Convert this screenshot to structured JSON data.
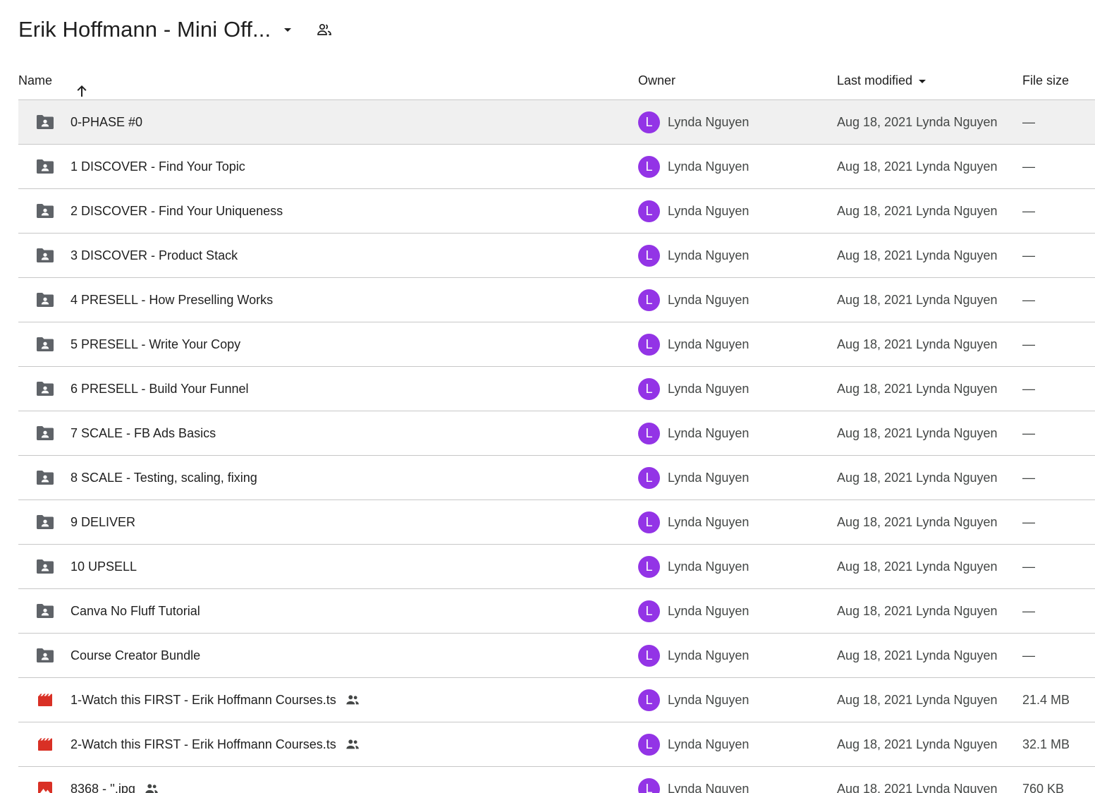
{
  "header": {
    "folder_title": "Erik Hoffmann - Mini Off...",
    "dropdown_icon": "arrow-drop-down-icon",
    "shared_icon": "people-outline-icon"
  },
  "columns": {
    "name": "Name",
    "owner": "Owner",
    "last_modified": "Last modified",
    "file_size": "File size",
    "sort_icon": "arrow-upward-icon",
    "modified_sort_icon": "arrow-drop-down-icon"
  },
  "colors": {
    "avatar": "#9334e6",
    "folder_icon": "#5f6368",
    "video_icon": "#d93025",
    "image_icon": "#d93025",
    "selected_row": "#f0f0f0",
    "divider": "#c7c7c7"
  },
  "rows": [
    {
      "type": "shared-folder",
      "icon": "shared-folder-icon",
      "name": "0-PHASE #0",
      "shared": false,
      "avatar_letter": "L",
      "owner": "Lynda Nguyen",
      "modified": "Aug 18, 2021 Lynda Nguyen",
      "size": "—",
      "selected": true
    },
    {
      "type": "shared-folder",
      "icon": "shared-folder-icon",
      "name": "1 DISCOVER - Find Your Topic",
      "shared": false,
      "avatar_letter": "L",
      "owner": "Lynda Nguyen",
      "modified": "Aug 18, 2021 Lynda Nguyen",
      "size": "—",
      "selected": false
    },
    {
      "type": "shared-folder",
      "icon": "shared-folder-icon",
      "name": "2 DISCOVER - Find Your Uniqueness",
      "shared": false,
      "avatar_letter": "L",
      "owner": "Lynda Nguyen",
      "modified": "Aug 18, 2021 Lynda Nguyen",
      "size": "—",
      "selected": false
    },
    {
      "type": "shared-folder",
      "icon": "shared-folder-icon",
      "name": "3 DISCOVER - Product Stack",
      "shared": false,
      "avatar_letter": "L",
      "owner": "Lynda Nguyen",
      "modified": "Aug 18, 2021 Lynda Nguyen",
      "size": "—",
      "selected": false
    },
    {
      "type": "shared-folder",
      "icon": "shared-folder-icon",
      "name": "4 PRESELL - How Preselling Works",
      "shared": false,
      "avatar_letter": "L",
      "owner": "Lynda Nguyen",
      "modified": "Aug 18, 2021 Lynda Nguyen",
      "size": "—",
      "selected": false
    },
    {
      "type": "shared-folder",
      "icon": "shared-folder-icon",
      "name": "5 PRESELL - Write Your Copy",
      "shared": false,
      "avatar_letter": "L",
      "owner": "Lynda Nguyen",
      "modified": "Aug 18, 2021 Lynda Nguyen",
      "size": "—",
      "selected": false
    },
    {
      "type": "shared-folder",
      "icon": "shared-folder-icon",
      "name": "6 PRESELL - Build Your Funnel",
      "shared": false,
      "avatar_letter": "L",
      "owner": "Lynda Nguyen",
      "modified": "Aug 18, 2021 Lynda Nguyen",
      "size": "—",
      "selected": false
    },
    {
      "type": "shared-folder",
      "icon": "shared-folder-icon",
      "name": "7 SCALE - FB Ads Basics",
      "shared": false,
      "avatar_letter": "L",
      "owner": "Lynda Nguyen",
      "modified": "Aug 18, 2021 Lynda Nguyen",
      "size": "—",
      "selected": false
    },
    {
      "type": "shared-folder",
      "icon": "shared-folder-icon",
      "name": "8 SCALE - Testing, scaling, fixing",
      "shared": false,
      "avatar_letter": "L",
      "owner": "Lynda Nguyen",
      "modified": "Aug 18, 2021 Lynda Nguyen",
      "size": "—",
      "selected": false
    },
    {
      "type": "shared-folder",
      "icon": "shared-folder-icon",
      "name": "9 DELIVER",
      "shared": false,
      "avatar_letter": "L",
      "owner": "Lynda Nguyen",
      "modified": "Aug 18, 2021 Lynda Nguyen",
      "size": "—",
      "selected": false
    },
    {
      "type": "shared-folder",
      "icon": "shared-folder-icon",
      "name": "10 UPSELL",
      "shared": false,
      "avatar_letter": "L",
      "owner": "Lynda Nguyen",
      "modified": "Aug 18, 2021 Lynda Nguyen",
      "size": "—",
      "selected": false
    },
    {
      "type": "shared-folder",
      "icon": "shared-folder-icon",
      "name": "Canva No Fluff Tutorial",
      "shared": false,
      "avatar_letter": "L",
      "owner": "Lynda Nguyen",
      "modified": "Aug 18, 2021 Lynda Nguyen",
      "size": "—",
      "selected": false
    },
    {
      "type": "shared-folder",
      "icon": "shared-folder-icon",
      "name": "Course Creator Bundle",
      "shared": false,
      "avatar_letter": "L",
      "owner": "Lynda Nguyen",
      "modified": "Aug 18, 2021 Lynda Nguyen",
      "size": "—",
      "selected": false
    },
    {
      "type": "video",
      "icon": "video-file-icon",
      "name": "1-Watch this FIRST - Erik Hoffmann Courses.ts",
      "shared": true,
      "avatar_letter": "L",
      "owner": "Lynda Nguyen",
      "modified": "Aug 18, 2021 Lynda Nguyen",
      "size": "21.4 MB",
      "selected": false
    },
    {
      "type": "video",
      "icon": "video-file-icon",
      "name": "2-Watch this FIRST - Erik Hoffmann Courses.ts",
      "shared": true,
      "avatar_letter": "L",
      "owner": "Lynda Nguyen",
      "modified": "Aug 18, 2021 Lynda Nguyen",
      "size": "32.1 MB",
      "selected": false
    },
    {
      "type": "image",
      "icon": "image-file-icon",
      "name": "8368 - ''.jpg",
      "shared": true,
      "avatar_letter": "L",
      "owner": "Lynda Nguyen",
      "modified": "Aug 18, 2021 Lynda Nguyen",
      "size": "760 KB",
      "selected": false
    }
  ]
}
